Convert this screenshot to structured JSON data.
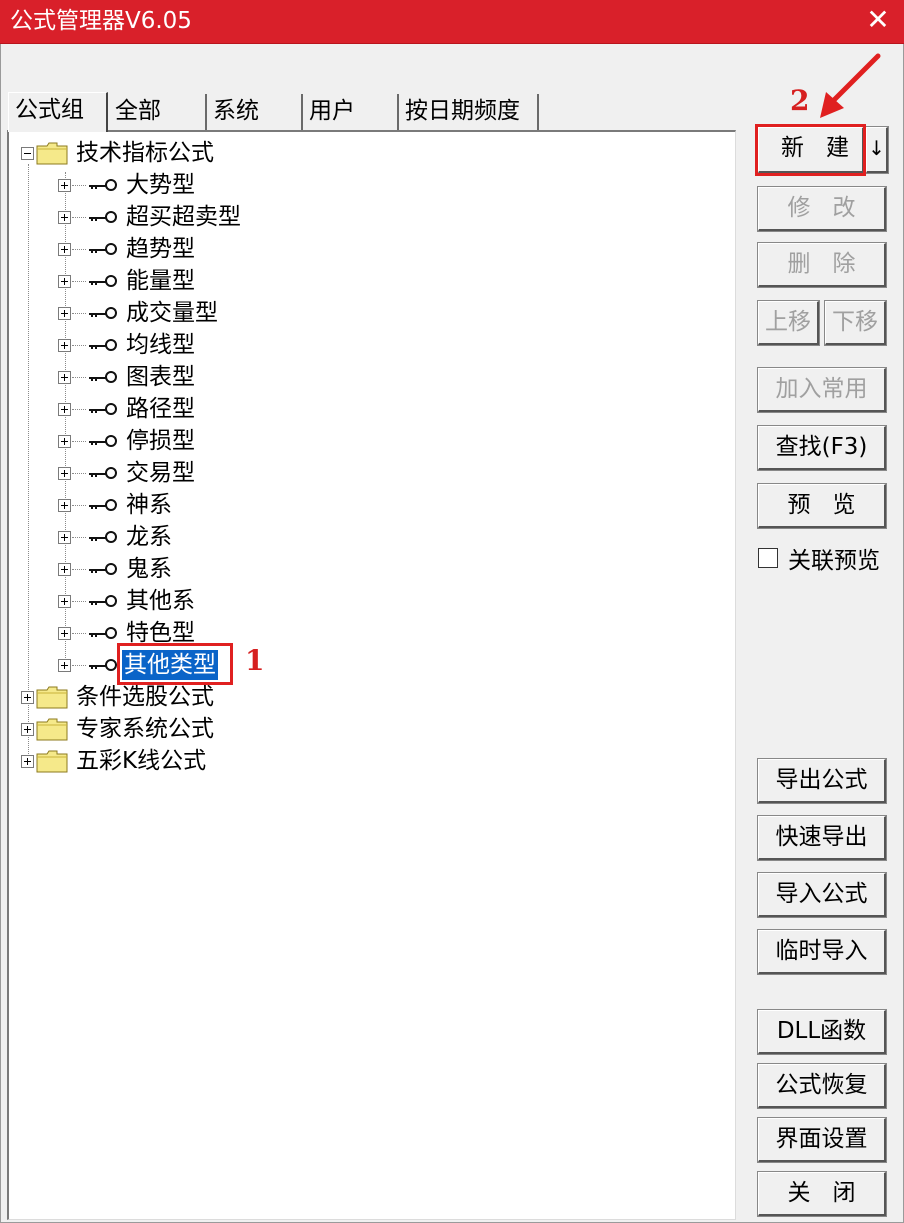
{
  "window": {
    "title": "公式管理器V6.05",
    "close_glyph": "✕"
  },
  "tabs": [
    {
      "label": "公式组",
      "active": true
    },
    {
      "label": "全部",
      "active": false
    },
    {
      "label": "系统",
      "active": false
    },
    {
      "label": "用户",
      "active": false
    },
    {
      "label": "按日期频度",
      "active": false
    }
  ],
  "tree": {
    "root": {
      "label": "技术指标公式",
      "expanded": true,
      "icon": "folder-icon"
    },
    "children": [
      {
        "label": "大势型"
      },
      {
        "label": "超买超卖型"
      },
      {
        "label": "趋势型"
      },
      {
        "label": "能量型"
      },
      {
        "label": "成交量型"
      },
      {
        "label": "均线型"
      },
      {
        "label": "图表型"
      },
      {
        "label": "路径型"
      },
      {
        "label": "停损型"
      },
      {
        "label": "交易型"
      },
      {
        "label": "神系"
      },
      {
        "label": "龙系"
      },
      {
        "label": "鬼系"
      },
      {
        "label": "其他系"
      },
      {
        "label": "特色型"
      },
      {
        "label": "其他类型",
        "selected": true
      }
    ],
    "other_roots": [
      {
        "label": "条件选股公式",
        "icon": "folder-icon"
      },
      {
        "label": "专家系统公式",
        "icon": "folder-icon"
      },
      {
        "label": "五彩K线公式",
        "icon": "folder-icon"
      }
    ]
  },
  "annotations": {
    "step1": "1",
    "step2": "2",
    "color": "#e02020"
  },
  "buttons": {
    "new": "新建",
    "new_arrow": "↓",
    "modify": "修改",
    "delete": "删除",
    "move_up": "上移",
    "move_down": "下移",
    "add_common": "加入常用",
    "find": "查找(F3)",
    "preview": "预览",
    "export_formula": "导出公式",
    "quick_export": "快速导出",
    "import_formula": "导入公式",
    "temp_import": "临时导入",
    "dll_function": "DLL函数",
    "restore_formula": "公式恢复",
    "ui_settings": "界面设置",
    "close": "关闭"
  },
  "checkbox": {
    "label": "关联预览",
    "checked": false
  },
  "colors": {
    "titlebar": "#d9202a",
    "selection": "#0a64c8",
    "disabled_text": "#a0a0a0"
  }
}
